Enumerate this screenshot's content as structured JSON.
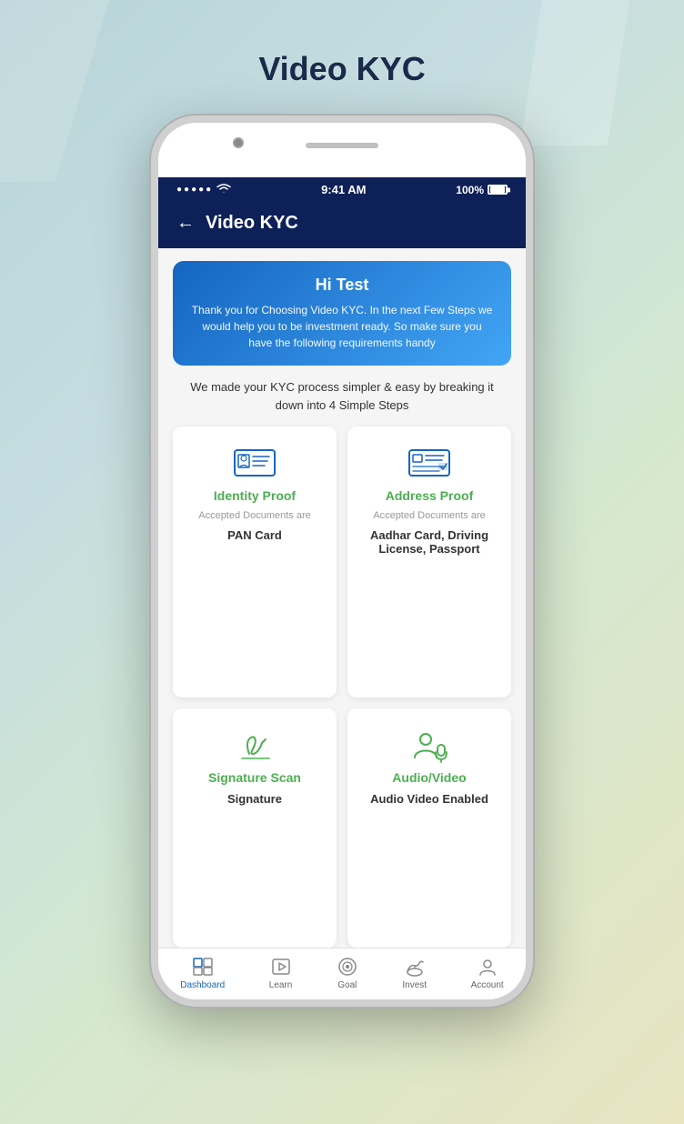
{
  "page": {
    "title": "Video KYC"
  },
  "statusBar": {
    "signal": "•••••",
    "wifi": "wifi",
    "time": "9:41 AM",
    "battery": "100%"
  },
  "header": {
    "back_label": "←",
    "title": "Video KYC"
  },
  "welcome": {
    "greeting": "Hi Test",
    "message": "Thank you for Choosing Video KYC. In the next Few Steps we would help you to be investment ready. So make sure you have the following requirements handy"
  },
  "steps": {
    "info": "We made your KYC process simpler & easy by breaking it down into 4 Simple Steps"
  },
  "cards": [
    {
      "id": "identity",
      "title": "Identity Proof",
      "subtitle": "Accepted Documents are",
      "doc": "PAN Card",
      "icon": "id-card-icon"
    },
    {
      "id": "address",
      "title": "Address Proof",
      "subtitle": "Accepted Documents are",
      "doc": "Aadhar Card, Driving License, Passport",
      "icon": "address-card-icon"
    },
    {
      "id": "signature",
      "title": "Signature Scan",
      "subtitle": "",
      "doc": "Signature",
      "icon": "signature-icon"
    },
    {
      "id": "audio",
      "title": "Audio/Video",
      "subtitle": "",
      "doc": "Audio Video Enabled",
      "icon": "audio-video-icon"
    }
  ],
  "bottomNav": [
    {
      "id": "dashboard",
      "label": "Dashboard",
      "icon": "dashboard-icon",
      "active": true
    },
    {
      "id": "learn",
      "label": "Learn",
      "icon": "learn-icon",
      "active": false
    },
    {
      "id": "goal",
      "label": "Goal",
      "icon": "goal-icon",
      "active": false
    },
    {
      "id": "invest",
      "label": "Invest",
      "icon": "invest-icon",
      "active": false
    },
    {
      "id": "account",
      "label": "Account",
      "icon": "account-icon",
      "active": false
    }
  ]
}
